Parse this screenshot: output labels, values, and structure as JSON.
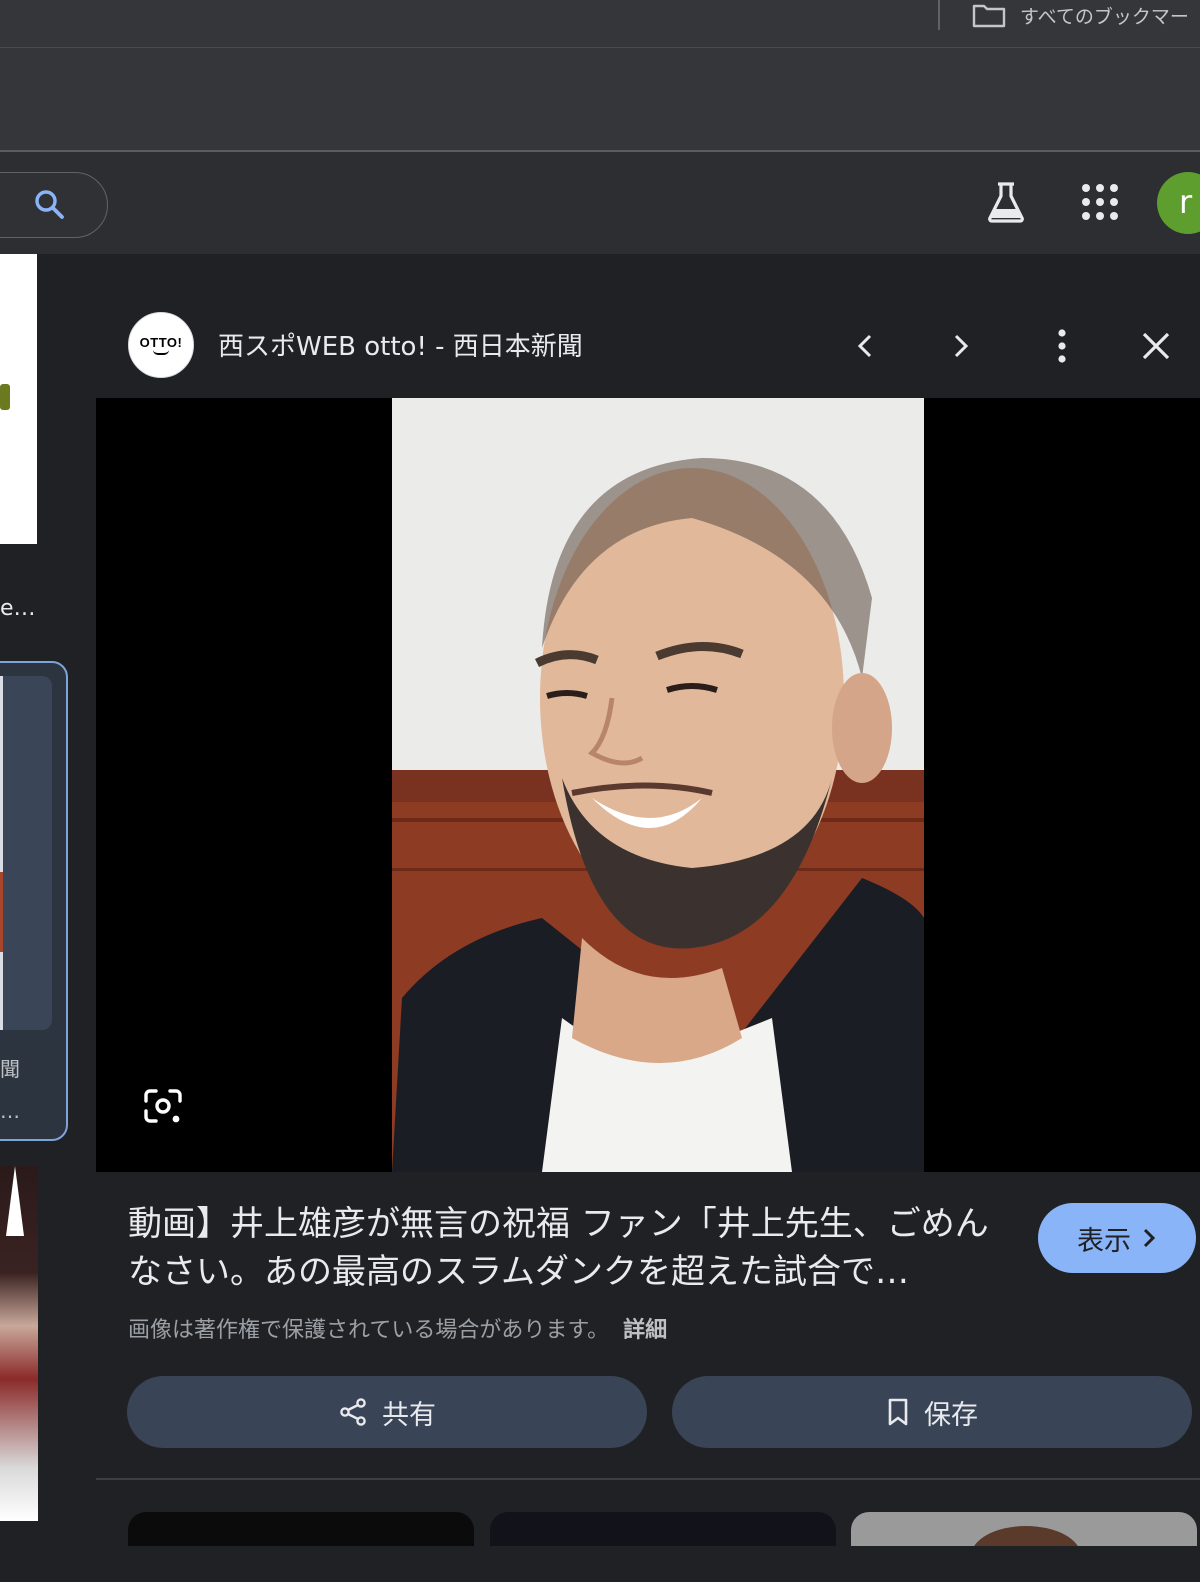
{
  "bookmarks_bar": {
    "all_bookmarks_label": "すべてのブックマー"
  },
  "header": {
    "avatar_letter": "r"
  },
  "left_results": {
    "caption1": "e…",
    "caption2_line1": "聞",
    "caption2_line2": "…"
  },
  "panel": {
    "logo_text": "OTTO!",
    "source_title": "西スポWEB otto! - 西日本新聞",
    "title": "動画】井上雄彦が無言の祝福 ファン「井上先生、ごめんなさい。あの最高のスラムダンクを超えた試合で…",
    "view_label": "表示",
    "copyright_text": "画像は著作権で保護されている場合があります。",
    "details_label": "詳細",
    "share_label": "共有",
    "save_label": "保存"
  },
  "colors": {
    "background": "#202124",
    "accent": "#8ab4f8",
    "button_bg": "#394457",
    "avatar_bg": "#5e9e2f"
  }
}
